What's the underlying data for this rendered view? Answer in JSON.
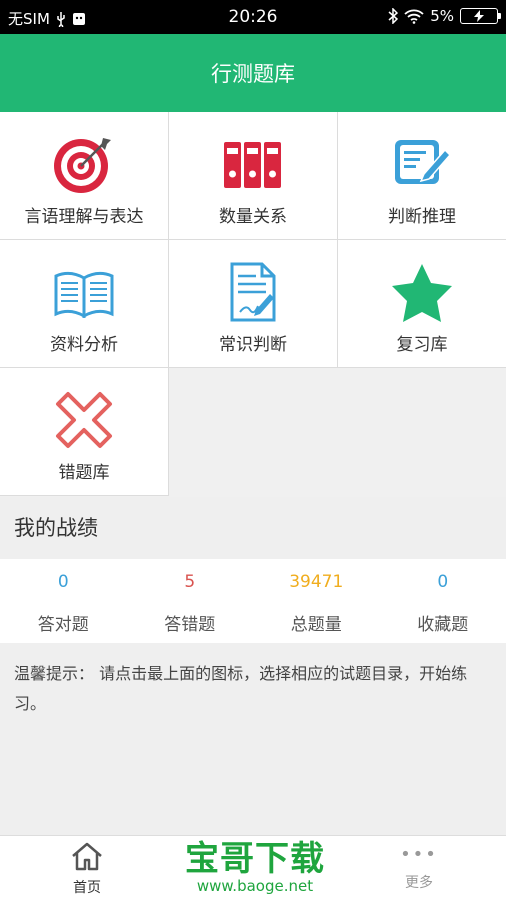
{
  "status_bar": {
    "carrier": "无SIM",
    "time": "20:26",
    "battery": "5%"
  },
  "header": {
    "title": "行测题库"
  },
  "categories": [
    {
      "label": "言语理解与表达",
      "icon": "target-icon"
    },
    {
      "label": "数量关系",
      "icon": "binders-icon"
    },
    {
      "label": "判断推理",
      "icon": "notepad-pencil-icon"
    },
    {
      "label": "资料分析",
      "icon": "open-book-icon"
    },
    {
      "label": "常识判断",
      "icon": "document-pen-icon"
    },
    {
      "label": "复习库",
      "icon": "star-icon"
    },
    {
      "label": "错题库",
      "icon": "x-mark-icon"
    }
  ],
  "record": {
    "title": "我的战绩",
    "stats": [
      {
        "value": "0",
        "label": "答对题",
        "color": "#3ba0d8"
      },
      {
        "value": "5",
        "label": "答错题",
        "color": "#d9534f"
      },
      {
        "value": "39471",
        "label": "总题量",
        "color": "#f0ad1e"
      },
      {
        "value": "0",
        "label": "收藏题",
        "color": "#3ba0d8"
      }
    ]
  },
  "tip": {
    "text": "温馨提示： 请点击最上面的图标，选择相应的试题目录，开始练习。"
  },
  "tabbar": {
    "home_label": "首页",
    "more_label": "更多",
    "more_glyph": "•••"
  },
  "watermark": {
    "brand": "宝哥下载",
    "url": "www.baoge.net"
  },
  "colors": {
    "primary": "#21b774",
    "red": "#d9263f",
    "blue": "#3ba0d8"
  }
}
